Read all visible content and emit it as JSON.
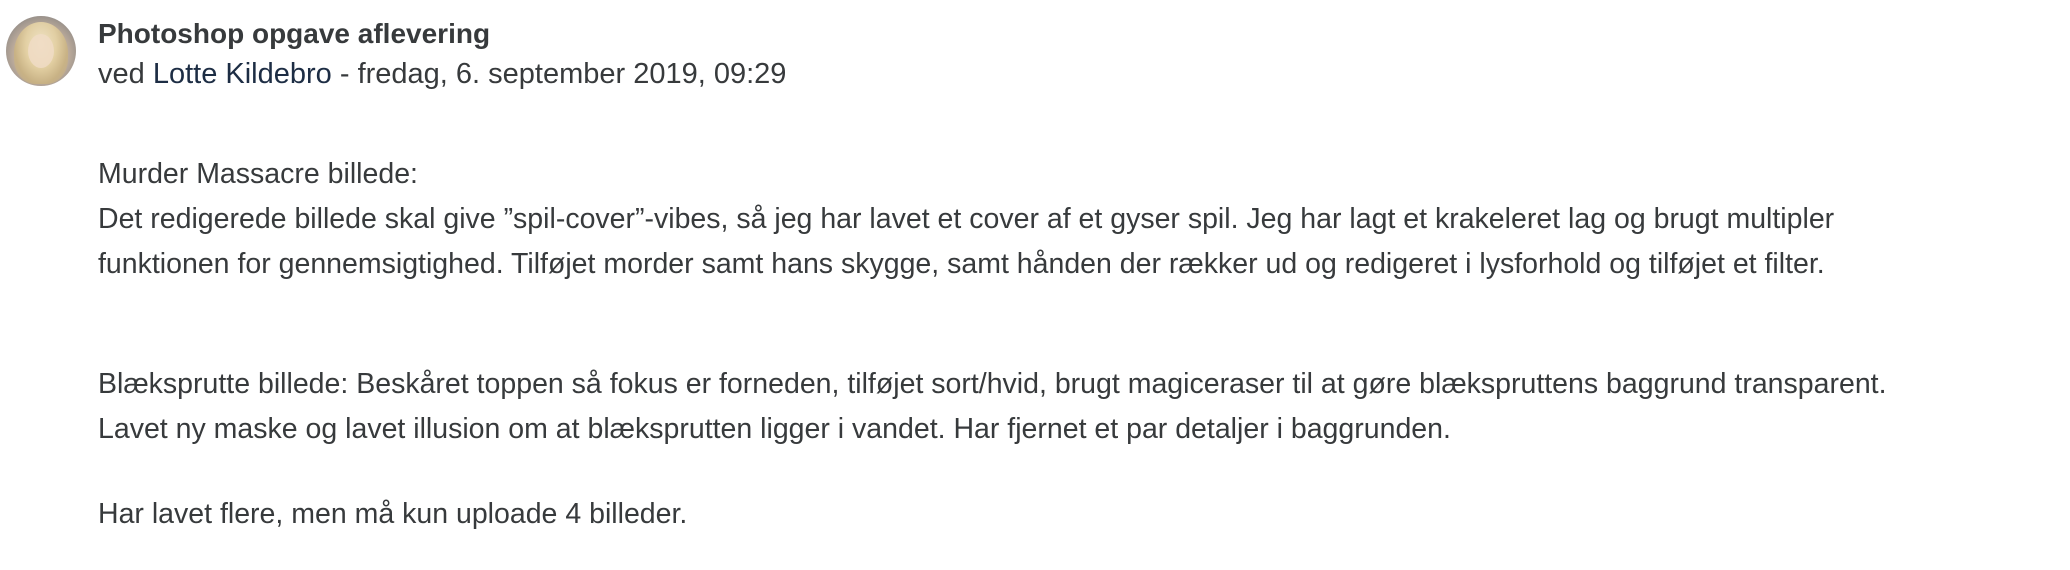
{
  "post": {
    "subject": "Photoshop opgave aflevering",
    "by_prefix": "ved",
    "author": "Lotte Kildebro",
    "date_separator": " - ",
    "date": "fredag, 6. september 2019, 09:29",
    "avatar_icon": "user-avatar-photo",
    "paragraphs": {
      "p1_line1": "Murder Massacre billede:",
      "p1_line2": "Det redigerede billede skal give ”spil-cover”-vibes, så jeg har lavet et cover af et gyser spil. Jeg har lagt et krakeleret lag og brugt multipler",
      "p1_line3": "funktionen for gennemsigtighed. Tilføjet morder samt hans skygge, samt hånden der rækker ud og redigeret i lysforhold og tilføjet et filter.",
      "p2_line1": "Blæksprutte billede: Beskåret toppen så fokus er forneden, tilføjet sort/hvid, brugt magiceraser til at gøre blækspruttens baggrund transparent.",
      "p2_line2": "Lavet ny maske og lavet illusion om at blæksprutten ligger i vandet. Har fjernet et par detaljer i baggrunden.",
      "p3_line1": "Har lavet flere, men må kun uploade 4 billeder."
    }
  },
  "colors": {
    "text": "#373a3c",
    "author_link": "#1d2d44",
    "background": "#ffffff"
  }
}
